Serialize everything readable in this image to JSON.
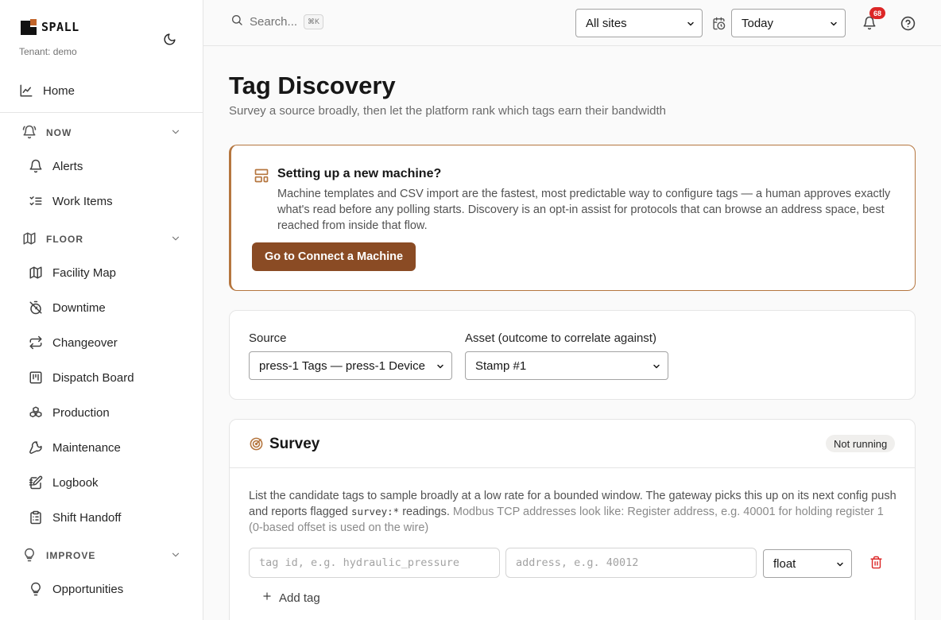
{
  "brand": {
    "name": "SPALL",
    "tenant": "Tenant: demo"
  },
  "sidebar": {
    "home": "Home",
    "sections": [
      {
        "label": "NOW",
        "items": [
          "Alerts",
          "Work Items"
        ]
      },
      {
        "label": "FLOOR",
        "items": [
          "Facility Map",
          "Downtime",
          "Changeover",
          "Dispatch Board",
          "Production",
          "Maintenance",
          "Logbook",
          "Shift Handoff"
        ]
      },
      {
        "label": "IMPROVE",
        "items": [
          "Opportunities"
        ]
      }
    ]
  },
  "header": {
    "search_placeholder": "Search...",
    "search_shortcut": "⌘K",
    "site_select": "All sites",
    "date_select": "Today",
    "notification_count": "68"
  },
  "page": {
    "title": "Tag Discovery",
    "subtitle": "Survey a source broadly, then let the platform rank which tags earn their bandwidth"
  },
  "callout": {
    "title": "Setting up a new machine?",
    "body": "Machine templates and CSV import are the fastest, most predictable way to configure tags — a human approves exactly what's read before any polling starts. Discovery is an opt-in assist for protocols that can browse an address space, best reached from inside that flow.",
    "button": "Go to Connect a Machine"
  },
  "source_card": {
    "source_label": "Source",
    "source_value": "press-1 Tags — press-1 Device",
    "asset_label": "Asset (outcome to correlate against)",
    "asset_value": "Stamp #1"
  },
  "survey": {
    "title": "Survey",
    "status": "Not running",
    "desc_part1": "List the candidate tags to sample broadly at a low rate for a bounded window. The gateway picks this up on its next config push and reports flagged ",
    "desc_code": "survey:*",
    "desc_part2": " readings.",
    "desc_muted": " Modbus TCP addresses look like: Register address, e.g. 40001 for holding register 1 (0-based offset is used on the wire)",
    "tag_placeholder": "tag id, e.g. hydraulic_pressure",
    "address_placeholder": "address, e.g. 40012",
    "type_value": "float",
    "add_tag": "Add tag"
  },
  "colors": {
    "accent": "#8a4b24",
    "callout_border": "#b5763f",
    "danger": "#dc2626"
  }
}
